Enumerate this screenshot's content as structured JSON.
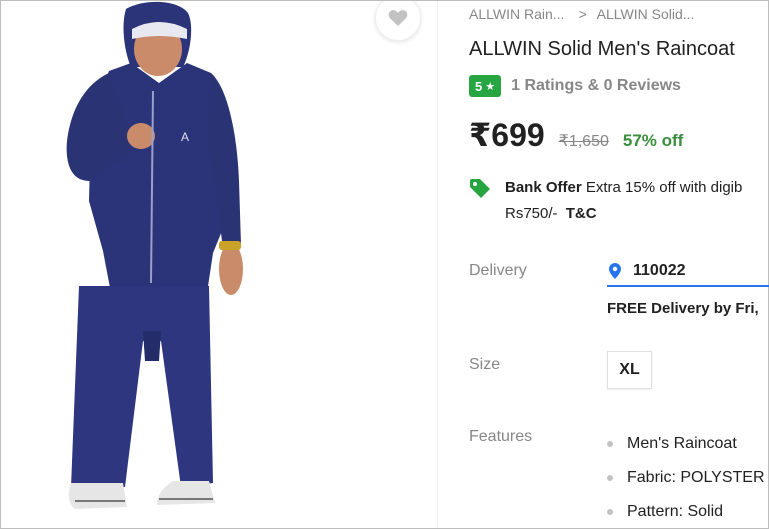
{
  "breadcrumb": {
    "items": [
      "ALLWIN Rain...",
      "ALLWIN Solid..."
    ],
    "separator": ">"
  },
  "product": {
    "title": "ALLWIN Solid Men's Raincoat",
    "rating": {
      "value": "5",
      "star": "★",
      "summary": "1 Ratings & 0 Reviews",
      "badge_color": "#26a541"
    },
    "price": "₹699",
    "mrp": "₹1,650",
    "discount": "57% off",
    "image_alt": "Man wearing navy blue raincoat"
  },
  "offer": {
    "type": "Bank Offer",
    "text": "Extra 15% off with digib",
    "text2": "Rs750/-",
    "tc": "T&C",
    "icon": "tag-icon"
  },
  "delivery": {
    "label": "Delivery",
    "pincode": "110022",
    "info": "FREE Delivery by Fri, ",
    "icon": "location-pin-icon"
  },
  "size": {
    "label": "Size",
    "selected": "XL"
  },
  "features": {
    "label": "Features",
    "items": [
      "Men's Raincoat",
      "Fabric: POLYSTER",
      "Pattern: Solid"
    ]
  },
  "colors": {
    "accent": "#2874f0",
    "discount": "#388e3c",
    "muted": "#878787",
    "raincoat": "#2b3478"
  }
}
